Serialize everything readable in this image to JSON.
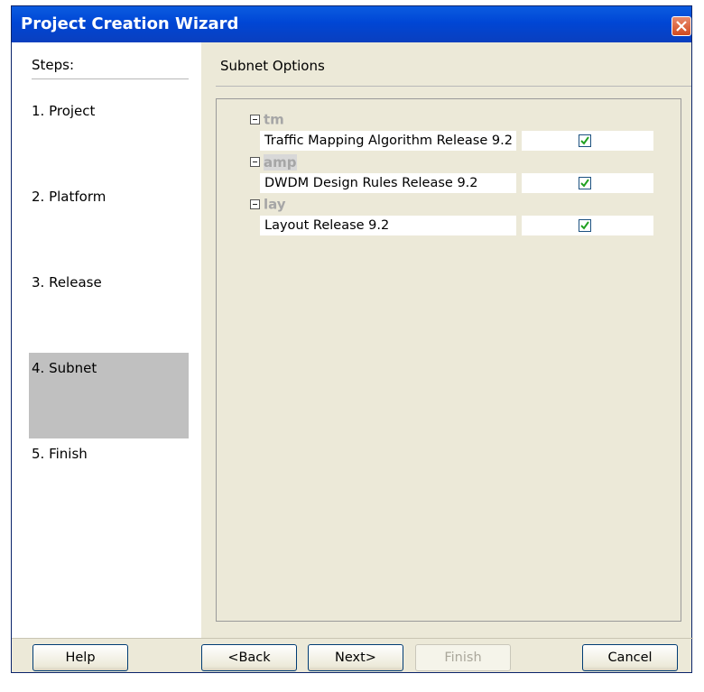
{
  "window": {
    "title": "Project Creation Wizard"
  },
  "steps": {
    "header": "Steps:",
    "items": [
      {
        "label": "1. Project",
        "active": false
      },
      {
        "label": "2. Platform",
        "active": false
      },
      {
        "label": "3. Release",
        "active": false
      },
      {
        "label": "4. Subnet",
        "active": true
      },
      {
        "label": "5. Finish",
        "active": false
      }
    ]
  },
  "content": {
    "header": "Subnet Options",
    "groups": [
      {
        "name": "tm",
        "item": "Traffic Mapping Algorithm Release 9.2",
        "checked": true
      },
      {
        "name": "amp",
        "item": "DWDM Design Rules Release 9.2",
        "checked": true
      },
      {
        "name": "lay",
        "item": "Layout Release 9.2",
        "checked": true
      }
    ]
  },
  "buttons": {
    "help": "Help",
    "back": "<Back",
    "next": "Next>",
    "finish": "Finish",
    "cancel": "Cancel"
  },
  "figure_id": "240144",
  "colors": {
    "title_bar": "#0046d5",
    "window_bg": "#ece9d8",
    "active_step": "#c0c0c0",
    "group_text": "#a6a6a6",
    "check_mark": "#21a121"
  }
}
